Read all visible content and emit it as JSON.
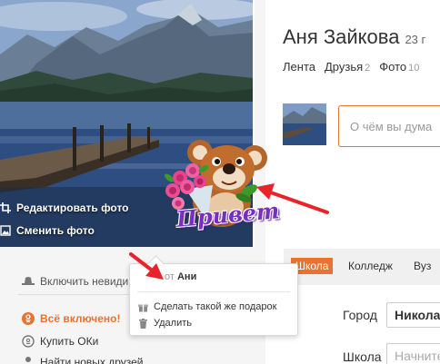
{
  "photo_actions": {
    "edit_label": "Редактировать фото",
    "change_label": "Сменить фото"
  },
  "sidebar": {
    "invisible_label": "Включить невиди",
    "all_on_label": "Всё включено!",
    "buy_ok_label": "Купить ОКи",
    "find_friends_label": "Найти новых друзей"
  },
  "profile": {
    "name": "Аня Зайкова",
    "age": "23 г",
    "tabs": [
      {
        "label": "Лента",
        "count": ""
      },
      {
        "label": "Друзья",
        "count": "2"
      },
      {
        "label": "Фото",
        "count": "10"
      }
    ]
  },
  "post": {
    "placeholder": "О чём вы дума"
  },
  "education": {
    "tabs": [
      "Школа",
      "Колледж",
      "Вуз"
    ],
    "active_tab": "Школа",
    "city_label": "Город",
    "city_value": "Николаев",
    "school_label": "Школа",
    "school_placeholder": "Начните"
  },
  "gift_popup": {
    "from_prefix": "от",
    "from_name": "Ани",
    "same_gift_label": "Сделать такой же подарок",
    "delete_label": "Удалить"
  },
  "sticker": {
    "text": "Привет"
  },
  "colors": {
    "accent": "#eb722e",
    "arrow": "#e8232a"
  },
  "icons": {
    "edit": "crop-icon",
    "change": "image-icon",
    "invisible": "hat-icon",
    "all_on": "ok-logo-icon",
    "buy_ok": "ok-coin-icon",
    "find_friends": "person-icon",
    "same_gift": "gift-icon",
    "delete": "trash-icon"
  }
}
